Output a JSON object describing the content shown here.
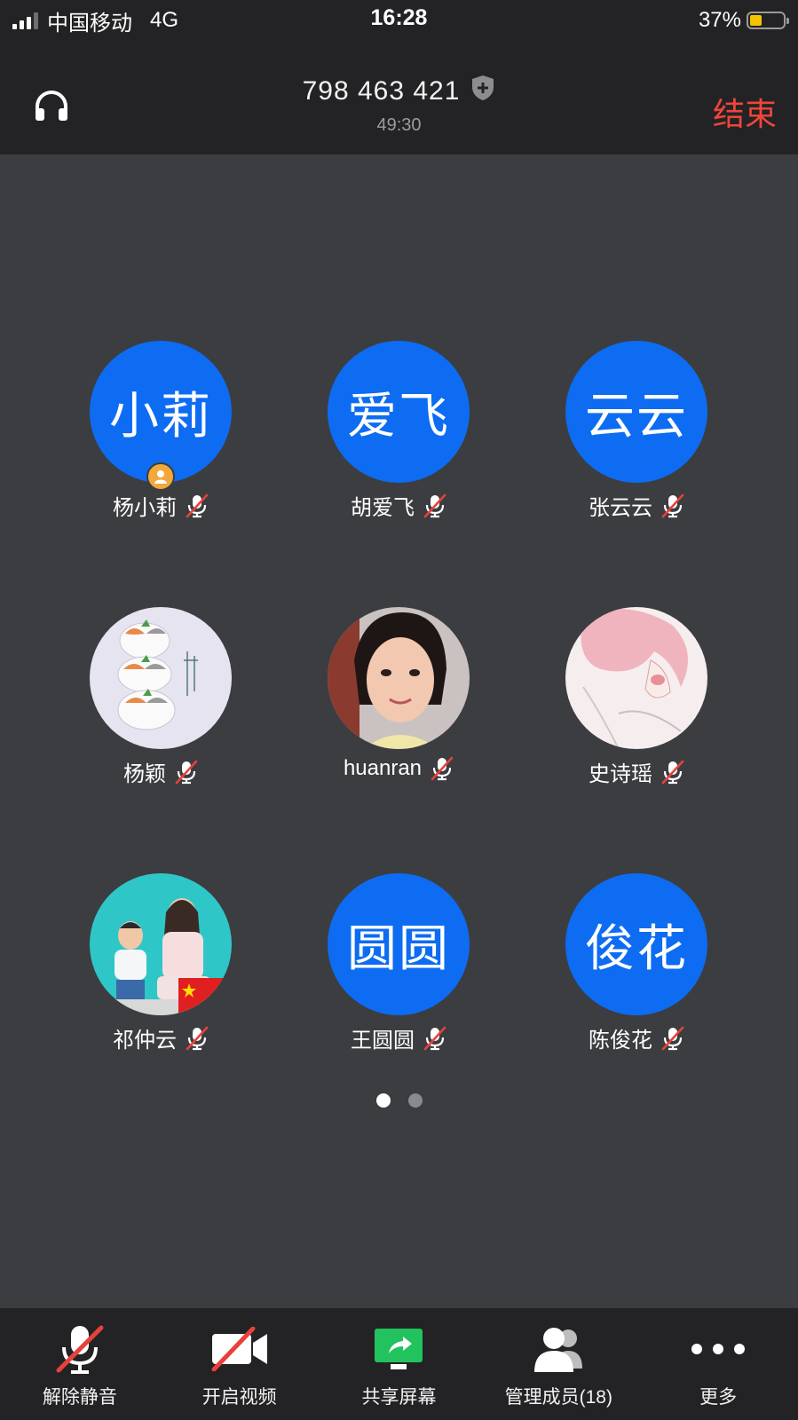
{
  "status_bar": {
    "carrier": "中国移动",
    "network": "4G",
    "time": "16:28",
    "battery_percent": "37%",
    "battery_level": 0.37,
    "signal_bars": 3
  },
  "header": {
    "meeting_id": "798 463 421",
    "duration": "49:30",
    "end_label": "结束",
    "end_color": "#f0453a",
    "audio_icon": "headphones-icon",
    "security_icon": "shield-icon"
  },
  "participants": [
    {
      "name": "杨小莉",
      "avatar_text": "小莉",
      "avatar_type": "text",
      "host": true,
      "muted": true
    },
    {
      "name": "胡爱飞",
      "avatar_text": "爱飞",
      "avatar_type": "text",
      "host": false,
      "muted": true
    },
    {
      "name": "张云云",
      "avatar_text": "云云",
      "avatar_type": "text",
      "host": false,
      "muted": true
    },
    {
      "name": "杨颖",
      "avatar_type": "image",
      "image": "cartoon-cats-avatar",
      "muted": true
    },
    {
      "name": "huanran",
      "avatar_type": "image",
      "image": "woman-portrait-avatar",
      "muted": true
    },
    {
      "name": "史诗瑶",
      "avatar_type": "image",
      "image": "pink-hair-anime-avatar",
      "muted": true
    },
    {
      "name": "祁仲云",
      "avatar_type": "image",
      "image": "mother-child-flag-avatar",
      "muted": true
    },
    {
      "name": "王圆圆",
      "avatar_text": "圆圆",
      "avatar_type": "text",
      "host": false,
      "muted": true
    },
    {
      "name": "陈俊花",
      "avatar_text": "俊花",
      "avatar_type": "text",
      "host": false,
      "muted": true
    }
  ],
  "colors": {
    "avatar_blue": "#0d6cf2",
    "background": "#3c3d40",
    "bar_background": "#232325",
    "mute_red": "#e8413b",
    "share_green": "#22c35e",
    "host_badge": "#f2a83a"
  },
  "pager": {
    "pages": 2,
    "current": 1
  },
  "toolbar": {
    "unmute": "解除静音",
    "start_video": "开启视频",
    "share_screen": "共享屏幕",
    "manage_members": "管理成员(18)",
    "more": "更多"
  }
}
